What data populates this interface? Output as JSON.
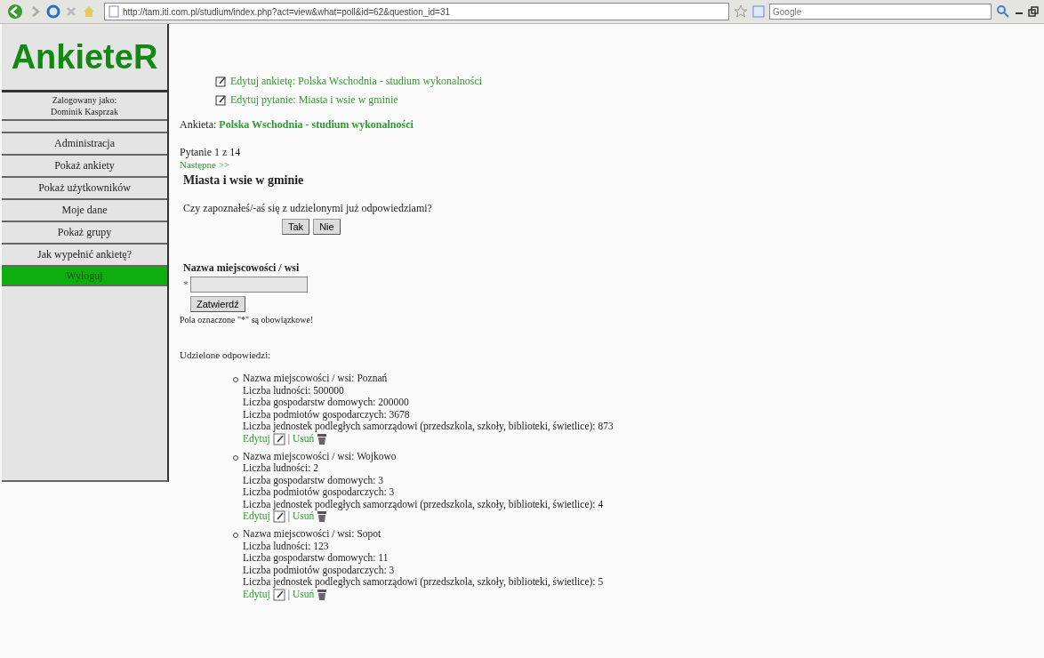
{
  "browser": {
    "url": "http://tam.iti.com.pl/studium/index.php?act=view&what=poll&id=62&question_id=31",
    "search_placeholder": "Google"
  },
  "sidebar": {
    "logo": "AnkieteR",
    "logged_in_label": "Zalogowany jako:",
    "user_name": "Dominik Kasprzak",
    "items": [
      {
        "label": "Administracja",
        "kind": "link"
      },
      {
        "label": "Pokaż ankiety",
        "kind": "link"
      },
      {
        "label": "Pokaż użytkowników",
        "kind": "link"
      },
      {
        "label": "Moje dane",
        "kind": "link"
      },
      {
        "label": "Pokaż grupy",
        "kind": "link"
      },
      {
        "label": "Jak wypełnić ankietę?",
        "kind": "link"
      },
      {
        "label": "Wyloguj",
        "kind": "logout"
      }
    ]
  },
  "edit_links": [
    "Edytuj ankietę: Polska Wschodnia - studium wykonalności",
    "Edytuj pytanie: Miasta i wsie w gminie"
  ],
  "survey": {
    "label": "Ankieta:",
    "name": "Polska Wschodnia - studium wykonalności"
  },
  "progress": "Pytanie 1 z 14",
  "next_link": "Następne >>",
  "question_title": "Miasta i wsie w gminie",
  "prompt": "Czy zapoznałeś/-aś się z udzielonymi już odpowiedziami?",
  "prompt_buttons": [
    "Tak",
    "Nie"
  ],
  "field": {
    "label": "Nazwa miejscowości / wsi",
    "required_mark": "*"
  },
  "submit": "Zatwierdź",
  "required_note": "Pola oznaczone \"*\" są obowiązkowe!",
  "answers_heading": "Udzielone odpowiedzi:",
  "answers": [
    {
      "lines": [
        "Nazwa miejscowości / wsi: Poznań",
        "Liczba ludności: 500000",
        "Liczba gospodarstw domowych: 200000",
        "Liczba podmiotów gospodarczych: 3678",
        "Liczba jednostek podległych samorządowi (przedszkola, szkoły, biblioteki, świetlice): 873"
      ],
      "edit": "Edytuj",
      "separator": "|",
      "delete": "Usuń"
    },
    {
      "lines": [
        "Nazwa miejscowości / wsi: Wojkowo",
        "Liczba ludności: 2",
        "Liczba gospodarstw domowych: 3",
        "Liczba podmiotów gospodarczych: 3",
        "Liczba jednostek podległych samorządowi (przedszkola, szkoły, biblioteki, świetlice): 4"
      ],
      "edit": "Edytuj",
      "separator": "|",
      "delete": "Usuń"
    },
    {
      "lines": [
        "Nazwa miejscowości / wsi: Sopot",
        "Liczba ludności: 123",
        "Liczba gospodarstw domowych: 11",
        "Liczba podmiotów gospodarczych: 3",
        "Liczba jednostek podległych samorządowi (przedszkola, szkoły, biblioteki, świetlice): 5"
      ],
      "edit": "Edytuj",
      "separator": "|",
      "delete": "Usuń"
    }
  ]
}
